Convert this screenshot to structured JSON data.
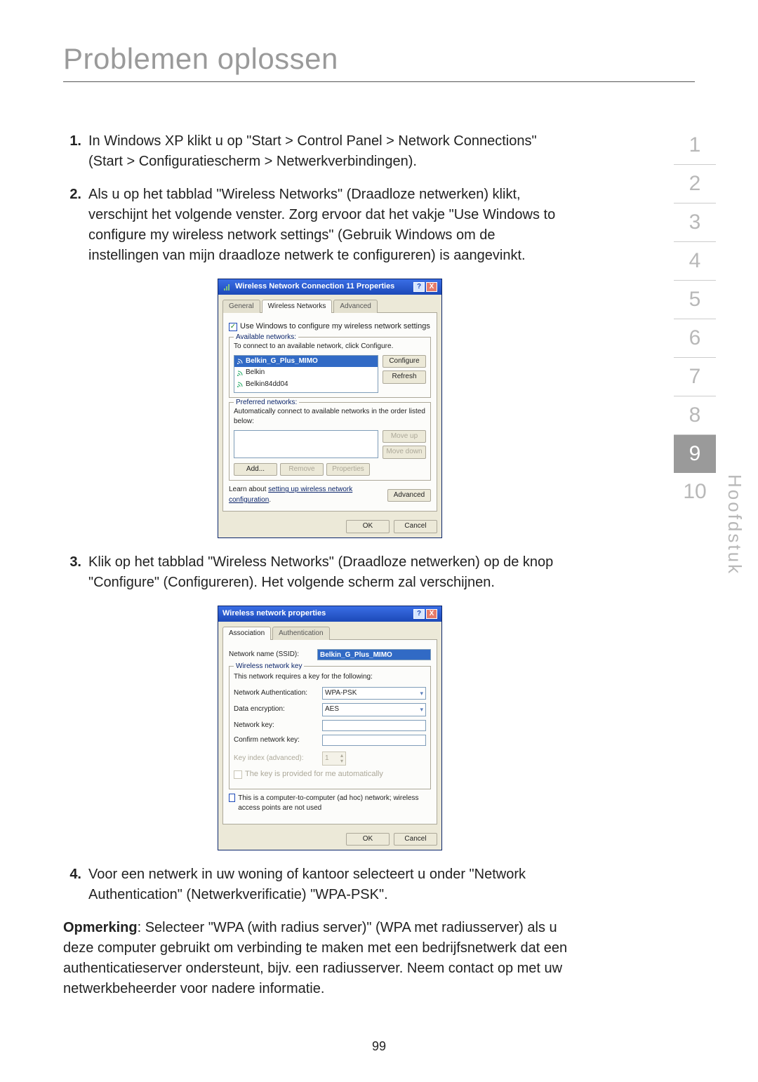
{
  "title": "Problemen oplossen",
  "page_number": "99",
  "sidebar": {
    "items": [
      "1",
      "2",
      "3",
      "4",
      "5",
      "6",
      "7",
      "8",
      "9",
      "10"
    ],
    "active_index": 8,
    "label": "Hoofdstuk"
  },
  "steps": {
    "s1": {
      "num": "1.",
      "text": "In Windows XP klikt u op \"Start > Control Panel > Network Connections\" (Start > Configuratiescherm > Netwerkverbindingen)."
    },
    "s2": {
      "num": "2.",
      "text": "Als u op het tabblad \"Wireless Networks\" (Draadloze netwerken) klikt, verschijnt het volgende venster. Zorg ervoor dat het vakje \"Use Windows to configure my wireless network settings\" (Gebruik Windows om de instellingen van mijn draadloze netwerk te configureren) is aangevinkt."
    },
    "s3": {
      "num": "3.",
      "text": "Klik op het tabblad \"Wireless Networks\" (Draadloze netwerken) op de knop \"Configure\" (Configureren). Het volgende scherm zal verschijnen."
    },
    "s4": {
      "num": "4.",
      "text": "Voor een netwerk in uw woning of kantoor selecteert u onder \"Network Authentication\" (Netwerkverificatie) \"WPA-PSK\"."
    }
  },
  "note": {
    "label": "Opmerking",
    "text": ": Selecteer \"WPA (with radius server)\" (WPA met radiusserver) als u deze computer gebruikt om verbinding te maken met een bedrijfsnetwerk dat een authenticatieserver ondersteunt, bijv. een radiusserver. Neem contact op met uw netwerkbeheerder voor nadere informatie."
  },
  "dialog1": {
    "title": "Wireless Network Connection 11 Properties",
    "tabs": {
      "general": "General",
      "wireless": "Wireless Networks",
      "advanced": "Advanced"
    },
    "use_windows": "Use Windows to configure my wireless network settings",
    "available": {
      "title": "Available networks:",
      "hint": "To connect to an available network, click Configure.",
      "items": [
        "Belkin_G_Plus_MIMO",
        "Belkin",
        "Belkin84dd04"
      ],
      "configure": "Configure",
      "refresh": "Refresh"
    },
    "preferred": {
      "title": "Preferred networks:",
      "hint": "Automatically connect to available networks in the order listed below:",
      "moveup": "Move up",
      "movedown": "Move down",
      "add": "Add...",
      "remove": "Remove",
      "properties": "Properties"
    },
    "learn1": "Learn about ",
    "learn_link": "setting up wireless network configuration",
    "learn2": ".",
    "adv": "Advanced",
    "ok": "OK",
    "cancel": "Cancel"
  },
  "dialog2": {
    "title": "Wireless network properties",
    "tabs": {
      "assoc": "Association",
      "auth": "Authentication"
    },
    "ssid_label": "Network name (SSID):",
    "ssid_value": "Belkin_G_Plus_MIMO",
    "group_title": "Wireless network key",
    "group_hint": "This network requires a key for the following:",
    "auth_label": "Network Authentication:",
    "auth_value": "WPA-PSK",
    "enc_label": "Data encryption:",
    "enc_value": "AES",
    "key_label": "Network key:",
    "confirm_label": "Confirm network key:",
    "index_label": "Key index (advanced):",
    "index_value": "1",
    "auto_key": "The key is provided for me automatically",
    "adhoc": "This is a computer-to-computer (ad hoc) network; wireless access points are not used",
    "ok": "OK",
    "cancel": "Cancel"
  }
}
